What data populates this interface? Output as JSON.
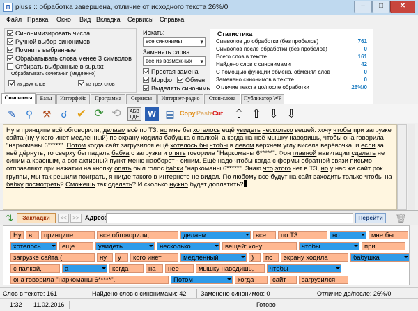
{
  "window": {
    "title": "pluss :: обработка завершена, отличие от исходного текста 26%/0",
    "app_icon": "П"
  },
  "menu": [
    "Файл",
    "Правка",
    "Окно",
    "Вид",
    "Вкладка",
    "Сервисы",
    "Справка"
  ],
  "options": {
    "checkboxes": [
      {
        "label": "Синонимизировать числа",
        "checked": true
      },
      {
        "label": "Ручной выбор синонимов",
        "checked": true
      },
      {
        "label": "Помнить выбранные",
        "checked": true
      },
      {
        "label": "Обрабатывать слова менее 3 символов",
        "checked": true
      },
      {
        "label": "Отбирать выбранные в sup.txt",
        "checked": false
      }
    ],
    "combinations_label": "Обрабатывать сочетания (медленно)",
    "combo_two": {
      "label": "из двух слов",
      "checked": true
    },
    "combo_three": {
      "label": "из трех слов",
      "checked": true
    }
  },
  "search": {
    "label": "Искать:",
    "value": "все синонимы",
    "replace_label": "Заменять слова:",
    "replace_value": "все из возможных"
  },
  "replace_opts": [
    {
      "label": "Простая замена",
      "checked": true
    },
    {
      "label": "Морфо",
      "checked": true
    },
    {
      "label": "Обмен",
      "checked": true
    },
    {
      "label": "Выделять синонимы",
      "checked": true
    }
  ],
  "stats": {
    "title": "Статистика",
    "rows": [
      {
        "label": "Символов до обработки (без пробелов)",
        "value": "761"
      },
      {
        "label": "Символов после обработки (без пробелов)",
        "value": "0"
      },
      {
        "label": "Всего слов в тексте",
        "value": "161"
      },
      {
        "label": "Найдено слов с синонимами",
        "value": "42"
      },
      {
        "label": "С помощью функции обмена, обменял слов",
        "value": "0"
      },
      {
        "label": "Заменено синонимов в тексте",
        "value": "0"
      },
      {
        "label": "Отличие текста до/после обработки",
        "value": "26%/0"
      }
    ]
  },
  "tabs": [
    "Синонимы",
    "Базы",
    "Интерфейс",
    "Программа",
    "Сервисы",
    "Интернет-радио",
    "Стоп-слова",
    "Публикатор WP"
  ],
  "toolbar": {
    "abv": "АБВ ГДЕ",
    "copy": "Copy",
    "paste": "Paste",
    "cut": "Cut"
  },
  "editor_segments": [
    {
      "t": "Ну в принципе всё обговорили, "
    },
    {
      "t": "делаем",
      "u": true
    },
    {
      "t": " всё по ТЗ. "
    },
    {
      "t": "но",
      "u": true
    },
    {
      "t": " мне бы "
    },
    {
      "t": "хотелось",
      "u": true
    },
    {
      "t": " ещё "
    },
    {
      "t": "увидеть",
      "u": true
    },
    {
      "t": " "
    },
    {
      "t": "несколько",
      "u": true
    },
    {
      "t": " вещей: хочу "
    },
    {
      "t": "чтобы",
      "u": true
    },
    {
      "t": " при загрузке сайта (ну у кого инет "
    },
    {
      "t": "медленный",
      "u": true
    },
    {
      "t": ") по экрану ходила "
    },
    {
      "t": "бабушка",
      "u": true
    },
    {
      "t": " с палкой, "
    },
    {
      "t": "а",
      "u": true
    },
    {
      "t": " когда на неё "
    },
    {
      "t": "мышку наводишь, "
    },
    {
      "t": "чтобы",
      "u": true
    },
    {
      "t": " она говорила \"наркоманы 6*****\". "
    },
    {
      "t": "Потом",
      "u": true
    },
    {
      "t": " когда сайт загрузился ещё "
    },
    {
      "t": "хотелось бы",
      "u": true
    },
    {
      "t": " "
    },
    {
      "t": "чтобы",
      "u": true
    },
    {
      "t": " в "
    },
    {
      "t": "левом",
      "u": true
    },
    {
      "t": " верхнем углу висела верёвочка, и "
    },
    {
      "t": "если",
      "u": true
    },
    {
      "t": " за неё дёрнуть, то сверху бы падала "
    },
    {
      "t": "бабка",
      "u": true
    },
    {
      "t": " с загрузки "
    },
    {
      "t": "и "
    },
    {
      "t": "опять",
      "u": true
    },
    {
      "t": " говорила \"Наркоманы 6*****\". Фон "
    },
    {
      "t": "главной",
      "u": true
    },
    {
      "t": " навигации "
    },
    {
      "t": "сделать",
      "u": true
    },
    {
      "t": " не синим "
    },
    {
      "t": "а",
      "u": true
    },
    {
      "t": " красным, "
    },
    {
      "t": "а",
      "u": true
    },
    {
      "t": " вот "
    },
    {
      "t": "активный",
      "u": true
    },
    {
      "t": " "
    },
    {
      "t": "пункт меню "
    },
    {
      "t": "наоборот",
      "u": true
    },
    {
      "t": " - синим. Ещё "
    },
    {
      "t": "надо",
      "u": true
    },
    {
      "t": " "
    },
    {
      "t": "чтобы",
      "u": true
    },
    {
      "t": " когда с формы "
    },
    {
      "t": "обратной",
      "u": true
    },
    {
      "t": " связи письмо отправляют при "
    },
    {
      "t": "нажатии на кнопку "
    },
    {
      "t": "опять",
      "u": true
    },
    {
      "t": " был голос "
    },
    {
      "t": "бабки",
      "u": true
    },
    {
      "t": " \"наркоманы 6*****\". Знаю "
    },
    {
      "t": "что",
      "u": true
    },
    {
      "t": " "
    },
    {
      "t": "этого",
      "u": true
    },
    {
      "t": " нет в ТЗ, "
    },
    {
      "t": "но",
      "u": true
    },
    {
      "t": " у нас же сайт "
    },
    {
      "t": "рок "
    },
    {
      "t": "группы",
      "u": true
    },
    {
      "t": ", мы так "
    },
    {
      "t": "решили",
      "u": true
    },
    {
      "t": " поиграть, я нигде такого в интернете не видел. По "
    },
    {
      "t": "любому",
      "u": true
    },
    {
      "t": " все "
    },
    {
      "t": "будут",
      "u": true
    },
    {
      "t": " на сайт "
    },
    {
      "t": "заходить "
    },
    {
      "t": "только",
      "u": true
    },
    {
      "t": " "
    },
    {
      "t": "чтобы",
      "u": true
    },
    {
      "t": " на "
    },
    {
      "t": "бабку",
      "u": true
    },
    {
      "t": " "
    },
    {
      "t": "посмотреть",
      "u": true
    },
    {
      "t": "? "
    },
    {
      "t": "Сможешь",
      "u": true
    },
    {
      "t": " так "
    },
    {
      "t": "сделать",
      "u": true
    },
    {
      "t": "? И сколько "
    },
    {
      "t": "нужно",
      "u": true
    },
    {
      "t": " будет доплатить?"
    }
  ],
  "urlbar": {
    "bookmarks": "Закладки",
    "address_label": "Адрес:",
    "go": "Перейти"
  },
  "grid_rows": [
    [
      {
        "t": "Ну",
        "s": false
      },
      {
        "t": "в",
        "s": false
      },
      {
        "t": "принципе",
        "s": false
      },
      {
        "t": "все обговорили,",
        "s": false
      },
      {
        "t": "делаем",
        "s": true
      },
      {
        "t": "все",
        "s": false
      },
      {
        "t": "по ТЗ.",
        "s": false
      },
      {
        "t": "но",
        "s": true
      },
      {
        "t": "мне бы",
        "s": false
      }
    ],
    [
      {
        "t": "хотелось",
        "s": true
      },
      {
        "t": "еще",
        "s": false
      },
      {
        "t": "увидеть",
        "s": true
      },
      {
        "t": "несколько",
        "s": true
      },
      {
        "t": "вещей: хочу",
        "s": false
      },
      {
        "t": "чтобы",
        "s": true
      },
      {
        "t": "при",
        "s": false
      }
    ],
    [
      {
        "t": "загрузке сайта (",
        "s": false
      },
      {
        "t": "ну",
        "s": false
      },
      {
        "t": "у",
        "s": false
      },
      {
        "t": "кого инет",
        "s": false
      },
      {
        "t": "медленный",
        "s": true
      },
      {
        "t": ")",
        "s": false
      },
      {
        "t": "по",
        "s": false
      },
      {
        "t": "экрану ходила",
        "s": false
      },
      {
        "t": "бабушка",
        "s": true
      }
    ],
    [
      {
        "t": "с палкой,",
        "s": false
      },
      {
        "t": "а",
        "s": true
      },
      {
        "t": "когда",
        "s": false
      },
      {
        "t": "на",
        "s": false
      },
      {
        "t": "нее",
        "s": false
      },
      {
        "t": "мышку наводишь,",
        "s": false
      },
      {
        "t": "чтобы",
        "s": true
      }
    ],
    [
      {
        "t": "она говорила \"наркоманы 6*****\".",
        "s": false
      },
      {
        "t": "Потом",
        "s": true
      },
      {
        "t": "когда",
        "s": false
      },
      {
        "t": "сайт",
        "s": false
      },
      {
        "t": "загрузился",
        "s": false
      }
    ]
  ],
  "status": {
    "words": "Слов в тексте: 161",
    "found": "Найдено слов с синонимами: 42",
    "replaced": "Заменено синонимов: 0",
    "diff": "Отличие до/после: 26%/0",
    "pos": "1:32",
    "date": "11.02.2016",
    "ready": "Готово"
  }
}
